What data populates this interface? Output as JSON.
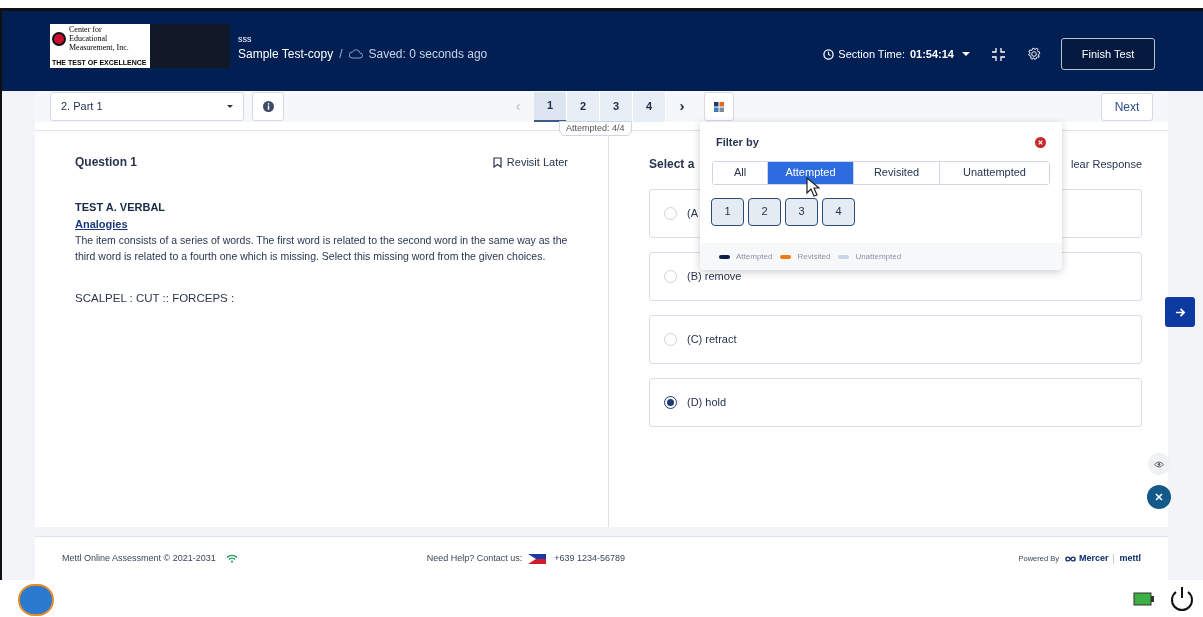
{
  "header": {
    "logo": {
      "lines": [
        "Center for",
        "Educational",
        "Measurement, Inc."
      ],
      "tagline": "THE TEST OF EXCELLENCE"
    },
    "test_label": "sss",
    "test_name": "Sample Test-copy",
    "separator": "/",
    "saved": "Saved: 0 seconds ago",
    "section_time_label": "Section Time:",
    "section_time": "01:54:14",
    "finish_button": "Finish Test"
  },
  "toolbar": {
    "section": "2. Part 1",
    "prev": "‹",
    "next_page": "›",
    "pages": [
      {
        "label": "1",
        "selected": true
      },
      {
        "label": "2",
        "selected": false
      },
      {
        "label": "3",
        "selected": false
      },
      {
        "label": "4",
        "selected": false
      }
    ],
    "attempted": "Attempted: 4/4",
    "next_button": "Next"
  },
  "question": {
    "title": "Question 1",
    "revisit": "Revisit Later",
    "heading": "TEST A. VERBAL",
    "subheading": "Analogies",
    "instructions": "The item consists of a series of words. The first word is related to the second word in the same way as the third word is related to a fourth one which is missing.  Select this missing word from the given choices.",
    "analogy": "SCALPEL : CUT :: FORCEPS :"
  },
  "answer": {
    "prompt": "Select a",
    "clear": "lear Response",
    "options": [
      {
        "letter": "(A",
        "selected": false
      },
      {
        "letter": "(B)",
        "text": "remove",
        "selected": false
      },
      {
        "letter": "(C)",
        "text": "retract",
        "selected": false
      },
      {
        "letter": "(D)",
        "text": "hold",
        "selected": true
      }
    ]
  },
  "filter": {
    "title": "Filter by",
    "tabs": [
      {
        "label": "All",
        "selected": false
      },
      {
        "label": "Attempted",
        "selected": true
      },
      {
        "label": "Revisited",
        "selected": false
      },
      {
        "label": "Unattempted",
        "selected": false
      }
    ],
    "questions": [
      "1",
      "2",
      "3",
      "4"
    ],
    "legend": [
      {
        "label": "Attempted",
        "color": "#0b1f4d"
      },
      {
        "label": "Revisited",
        "color": "#f07a1a"
      },
      {
        "label": "Unattempted",
        "color": "#c5d6e8"
      }
    ]
  },
  "footer": {
    "copyright": "Mettl Online Assessment © 2021-2031",
    "help": "Need Help? Contact us:",
    "phone": "+639 1234-56789",
    "powered": "Powered By",
    "brand": "Mercer",
    "brand2": "mettl"
  }
}
